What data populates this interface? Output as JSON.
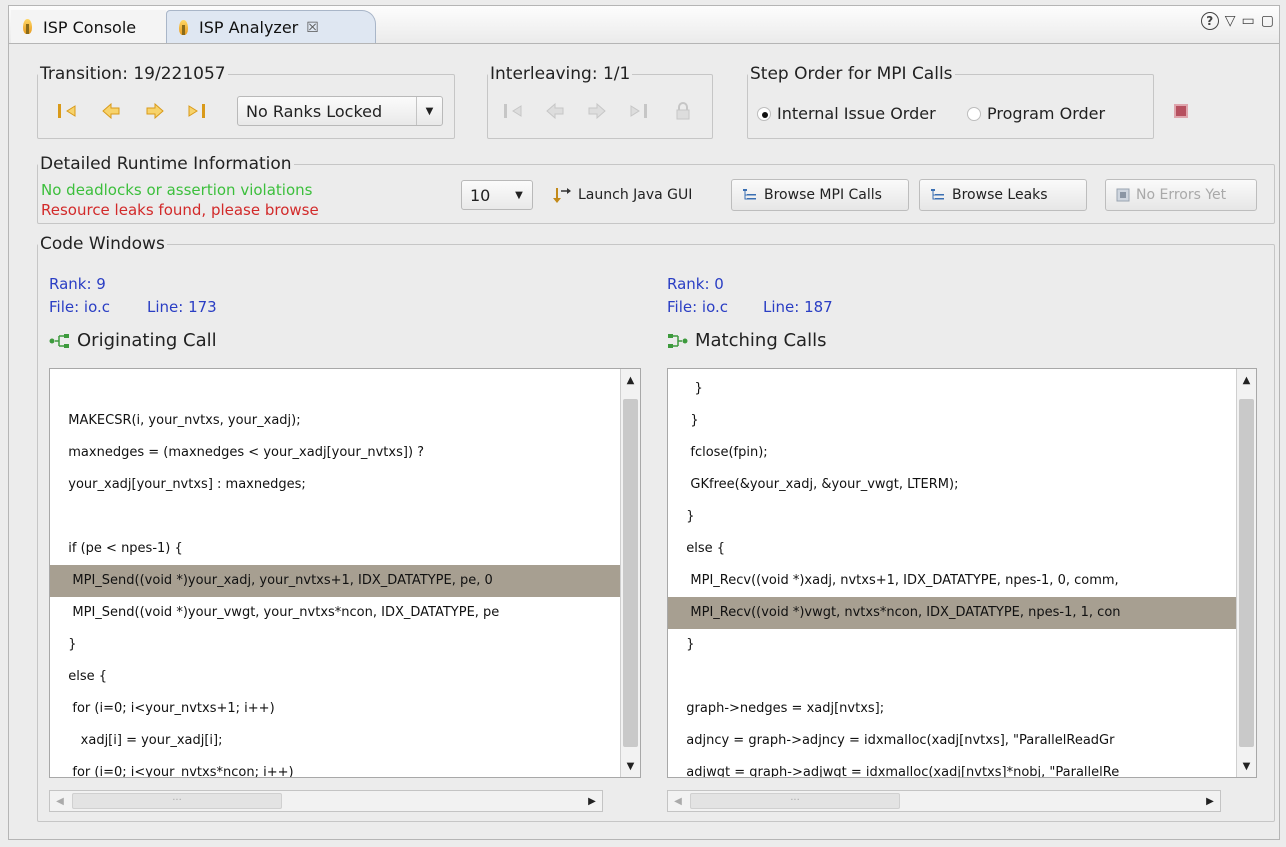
{
  "tabs": [
    {
      "label": "ISP Console",
      "icon": "flame-icon",
      "active": false
    },
    {
      "label": "ISP Analyzer",
      "icon": "flame-icon",
      "active": true,
      "close": "☒"
    }
  ],
  "window_controls": {
    "help": "?",
    "menu": "▽",
    "minimize": "▭",
    "maximize": "▢"
  },
  "transition": {
    "label": "Transition: 19/221057",
    "buttons": [
      "first-icon",
      "prev-icon",
      "next-icon",
      "last-icon"
    ],
    "rank_combo": "No Ranks Locked"
  },
  "interleaving": {
    "label": "Interleaving: 1/1",
    "buttons": [
      "first-icon",
      "prev-icon",
      "next-icon",
      "last-icon",
      "lock-icon"
    ]
  },
  "step_order": {
    "label": "Step Order for MPI Calls",
    "options": [
      {
        "label": "Internal Issue Order",
        "selected": true
      },
      {
        "label": "Program Order",
        "selected": false
      }
    ]
  },
  "runtime": {
    "label": "Detailed Runtime Information",
    "ok_message": "No deadlocks or assertion violations",
    "leak_message": "Resource leaks found, please browse",
    "count_combo": "10",
    "launch_button": "Launch Java GUI",
    "browse_calls_button": "Browse MPI Calls",
    "browse_leaks_button": "Browse Leaks",
    "errors_button": "No Errors Yet"
  },
  "code_windows": {
    "label": "Code Windows",
    "left": {
      "rank": "Rank: 9",
      "file": "File: io.c",
      "line": "Line: 173",
      "title": "Originating Call",
      "highlight_index": 6,
      "lines": [
        "",
        "  MAKECSR(i, your_nvtxs, your_xadj);",
        "  maxnedges = (maxnedges < your_xadj[your_nvtxs]) ?",
        "  your_xadj[your_nvtxs] : maxnedges;",
        "",
        "  if (pe < npes-1) {",
        "   MPI_Send((void *)your_xadj, your_nvtxs+1, IDX_DATATYPE, pe, 0",
        "   MPI_Send((void *)your_vwgt, your_nvtxs*ncon, IDX_DATATYPE, pe",
        "  }",
        "  else {",
        "   for (i=0; i<your_nvtxs+1; i++)",
        "     xadj[i] = your_xadj[i];",
        "   for (i=0; i<your_nvtxs*ncon; i++)"
      ]
    },
    "right": {
      "rank": "Rank: 0",
      "file": "File: io.c",
      "line": "Line: 187",
      "title": "Matching Calls",
      "highlight_index": 7,
      "lines": [
        "    }",
        "   }",
        "   fclose(fpin);",
        "   GKfree(&your_xadj, &your_vwgt, LTERM);",
        "  }",
        "  else {",
        "   MPI_Recv((void *)xadj, nvtxs+1, IDX_DATATYPE, npes-1, 0, comm,",
        "   MPI_Recv((void *)vwgt, nvtxs*ncon, IDX_DATATYPE, npes-1, 1, con",
        "  }",
        "",
        "  graph->nedges = xadj[nvtxs];",
        "  adjncy = graph->adjncy = idxmalloc(xadj[nvtxs], \"ParallelReadGr",
        "  adjwgt = graph->adjwgt = idxmalloc(xadj[nvtxs]*nobj, \"ParallelRe"
      ]
    }
  }
}
